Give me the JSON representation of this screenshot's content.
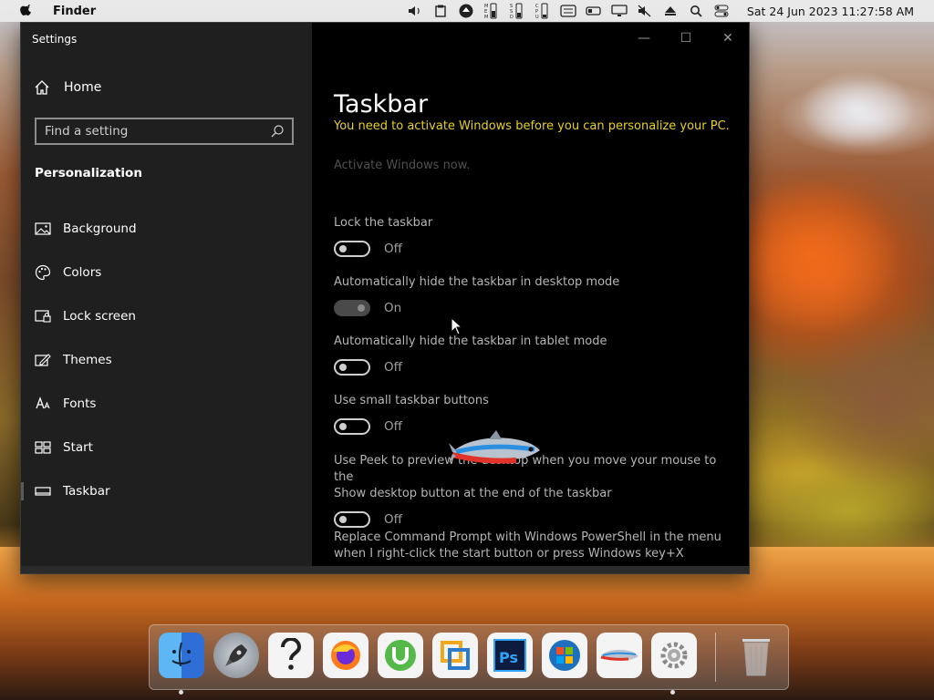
{
  "menubar": {
    "app_name": "Finder",
    "clock": "Sat 24 Jun 2023  11:27:58 AM",
    "status_icons": [
      "volume-icon",
      "clipboard-icon",
      "upload-icon",
      "memory-meter-icon",
      "ssd-meter-icon",
      "cpu-meter-icon",
      "display-icon",
      "battery-icon",
      "monitor-icon",
      "mute-icon",
      "eject-icon",
      "spotlight-icon",
      "control-center-icon"
    ]
  },
  "window": {
    "title": "Settings",
    "controls": {
      "minimize": "—",
      "maximize": "☐",
      "close": "✕"
    }
  },
  "sidebar": {
    "home_label": "Home",
    "search_placeholder": "Find a setting",
    "section_title": "Personalization",
    "items": [
      {
        "label": "Background",
        "icon": "picture-icon"
      },
      {
        "label": "Colors",
        "icon": "palette-icon"
      },
      {
        "label": "Lock screen",
        "icon": "lock-screen-icon"
      },
      {
        "label": "Themes",
        "icon": "themes-icon"
      },
      {
        "label": "Fonts",
        "icon": "fonts-icon"
      },
      {
        "label": "Start",
        "icon": "start-icon"
      },
      {
        "label": "Taskbar",
        "icon": "taskbar-icon"
      }
    ]
  },
  "main": {
    "title": "Taskbar",
    "warning": "You need to activate Windows before you can personalize your PC.",
    "activate_link": "Activate Windows now.",
    "settings": [
      {
        "label": "Lock the taskbar",
        "state": "Off"
      },
      {
        "label": "Automatically hide the taskbar in desktop mode",
        "state": "On"
      },
      {
        "label": "Automatically hide the taskbar in tablet mode",
        "state": "Off"
      },
      {
        "label": "Use small taskbar buttons",
        "state": "Off"
      },
      {
        "label_line1": "Use Peek to preview the desktop when you move your mouse to the",
        "label_line2": "Show desktop button at the end of the taskbar",
        "state": "Off"
      },
      {
        "label_line1": "Replace Command Prompt with Windows PowerShell in the menu",
        "label_line2": "when I right-click the start button or press Windows key+X"
      }
    ]
  },
  "dock": {
    "apps": [
      "finder-icon",
      "launchpad-icon",
      "help-icon",
      "firefox-icon",
      "utorrent-icon",
      "vmware-icon",
      "photoshop-icon",
      "windows-icon",
      "fish-app-icon",
      "system-preferences-icon",
      "trash-icon"
    ]
  },
  "colors": {
    "warning": "#e6d02a",
    "sidebar_bg": "#1f1f1f",
    "main_bg": "#000000"
  }
}
